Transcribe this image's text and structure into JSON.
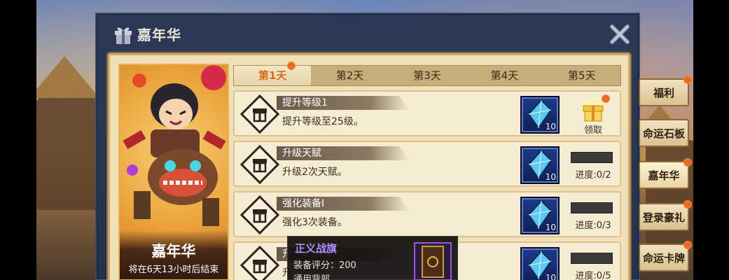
{
  "dialog": {
    "title": "嘉年华"
  },
  "banner": {
    "title": "嘉年华",
    "subtitle": "将在6天13小时后结束"
  },
  "tabs": [
    {
      "label": "第1天",
      "active": true,
      "badge": true
    },
    {
      "label": "第2天",
      "active": false,
      "badge": false
    },
    {
      "label": "第3天",
      "active": false,
      "badge": false
    },
    {
      "label": "第4天",
      "active": false,
      "badge": false
    },
    {
      "label": "第5天",
      "active": false,
      "badge": false
    }
  ],
  "tasks": [
    {
      "title": "提升等级1",
      "desc": "提升等级至25级。",
      "reward_count": "10",
      "status": "claim",
      "claim_label": "领取",
      "progress": ""
    },
    {
      "title": "升级天赋",
      "desc": "升级2次天赋。",
      "reward_count": "10",
      "status": "progress",
      "claim_label": "",
      "progress": "进度:0/2"
    },
    {
      "title": "强化装备I",
      "desc": "强化3次装备。",
      "reward_count": "10",
      "status": "progress",
      "claim_label": "",
      "progress": "进度:0/3"
    },
    {
      "title": "升",
      "desc": "升",
      "reward_count": "10",
      "status": "progress",
      "claim_label": "",
      "progress": "进度:0/5"
    }
  ],
  "tooltip": {
    "name": "正义战旗",
    "score": "装备评分：200",
    "bag": "通用背部"
  },
  "side_tabs": [
    {
      "label": "福利",
      "badge": true
    },
    {
      "label": "命运石板",
      "badge": false
    },
    {
      "label": "嘉年华",
      "badge": true,
      "active": true
    },
    {
      "label": "登录豪礼",
      "badge": true
    },
    {
      "label": "命运卡牌",
      "badge": true
    }
  ],
  "colors": {
    "accent_orange": "#f06a1e",
    "dialog_bg": "#2c3956",
    "parchment": "#f0e0b8",
    "active_tab_text": "#d86a18",
    "tooltip_name": "#b58cff"
  }
}
